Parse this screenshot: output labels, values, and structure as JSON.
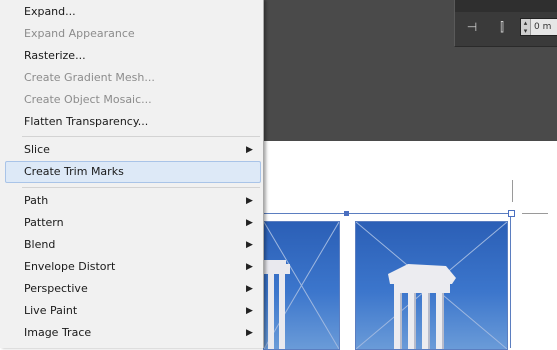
{
  "menu": {
    "items": [
      {
        "label": "Expand...",
        "enabled": true
      },
      {
        "label": "Expand Appearance",
        "enabled": false
      },
      {
        "label": "Rasterize...",
        "enabled": true
      },
      {
        "label": "Create Gradient Mesh...",
        "enabled": false
      },
      {
        "label": "Create Object Mosaic...",
        "enabled": false
      },
      {
        "label": "Flatten Transparency...",
        "enabled": true
      },
      {
        "label": "Slice",
        "enabled": true,
        "submenu": true
      },
      {
        "label": "Create Trim Marks",
        "enabled": true,
        "highlighted": true
      },
      {
        "label": "Path",
        "enabled": true,
        "submenu": true
      },
      {
        "label": "Pattern",
        "enabled": true,
        "submenu": true
      },
      {
        "label": "Blend",
        "enabled": true,
        "submenu": true
      },
      {
        "label": "Envelope Distort",
        "enabled": true,
        "submenu": true
      },
      {
        "label": "Perspective",
        "enabled": true,
        "submenu": true
      },
      {
        "label": "Live Paint",
        "enabled": true,
        "submenu": true
      },
      {
        "label": "Image Trace",
        "enabled": true,
        "submenu": true
      }
    ],
    "submenu_arrow": "▶"
  },
  "control_panel": {
    "spin_value": "0 m",
    "icons": [
      "align-left-icon",
      "align-center-icon"
    ]
  },
  "colors": {
    "menu_bg": "#f1f1f1",
    "highlight": "#dde9f7",
    "workspace": "#4a4a4a",
    "photo_sky": "#3c76cc"
  }
}
